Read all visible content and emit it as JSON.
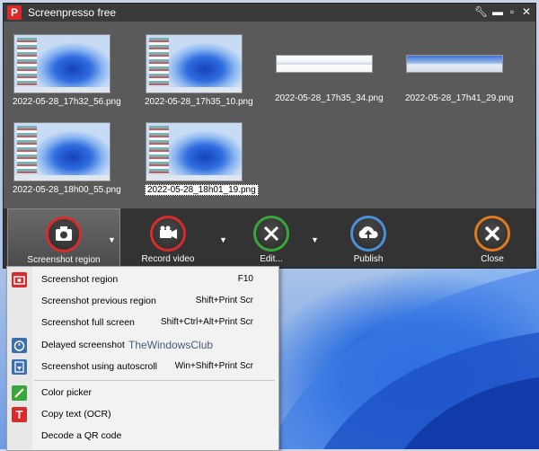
{
  "app": {
    "title": "Screenpresso free"
  },
  "titlebar_controls": [
    "wrench-icon",
    "minimize-icon",
    "maximize-icon",
    "close-icon"
  ],
  "thumbnails": [
    {
      "filename": "2022-05-28_17h32_56.png",
      "kind": "desktop",
      "selected": false
    },
    {
      "filename": "2022-05-28_17h35_10.png",
      "kind": "desktop",
      "selected": false
    },
    {
      "filename": "2022-05-28_17h35_34.png",
      "kind": "strip",
      "selected": false
    },
    {
      "filename": "2022-05-28_17h41_29.png",
      "kind": "strip-blue",
      "selected": false
    },
    {
      "filename": "2022-05-28_18h00_55.png",
      "kind": "desktop",
      "selected": false
    },
    {
      "filename": "2022-05-28_18h01_19.png",
      "kind": "desktop",
      "selected": true
    }
  ],
  "toolbar": {
    "screenshot": "Screenshot region",
    "record": "Record video",
    "edit": "Edit...",
    "publish": "Publish",
    "close": "Close"
  },
  "menu": {
    "items": [
      {
        "label": "Screenshot region",
        "shortcut": "F10",
        "icon": "camera-icon"
      },
      {
        "label": "Screenshot previous region",
        "shortcut": "Shift+Print Scr"
      },
      {
        "label": "Screenshot full screen",
        "shortcut": "Shift+Ctrl+Alt+Print Scr"
      },
      {
        "label": "Delayed screenshot",
        "shortcut": "",
        "icon": "timer-icon"
      },
      {
        "label": "Screenshot using autoscroll",
        "shortcut": "Win+Shift+Print Scr",
        "icon": "autoscroll-icon"
      },
      {
        "label": "Color picker",
        "shortcut": "",
        "icon": "color-picker-icon"
      },
      {
        "label": "Copy text (OCR)",
        "shortcut": "",
        "icon": "ocr-icon"
      },
      {
        "label": "Decode a QR code",
        "shortcut": ""
      }
    ]
  },
  "watermark": "TheWindowsClub",
  "colors": {
    "accent_red": "#d92b2b",
    "toolbar_bg": "#333333",
    "gallery_bg": "#5a5a5a",
    "menu_bg": "#f2f2f2"
  }
}
